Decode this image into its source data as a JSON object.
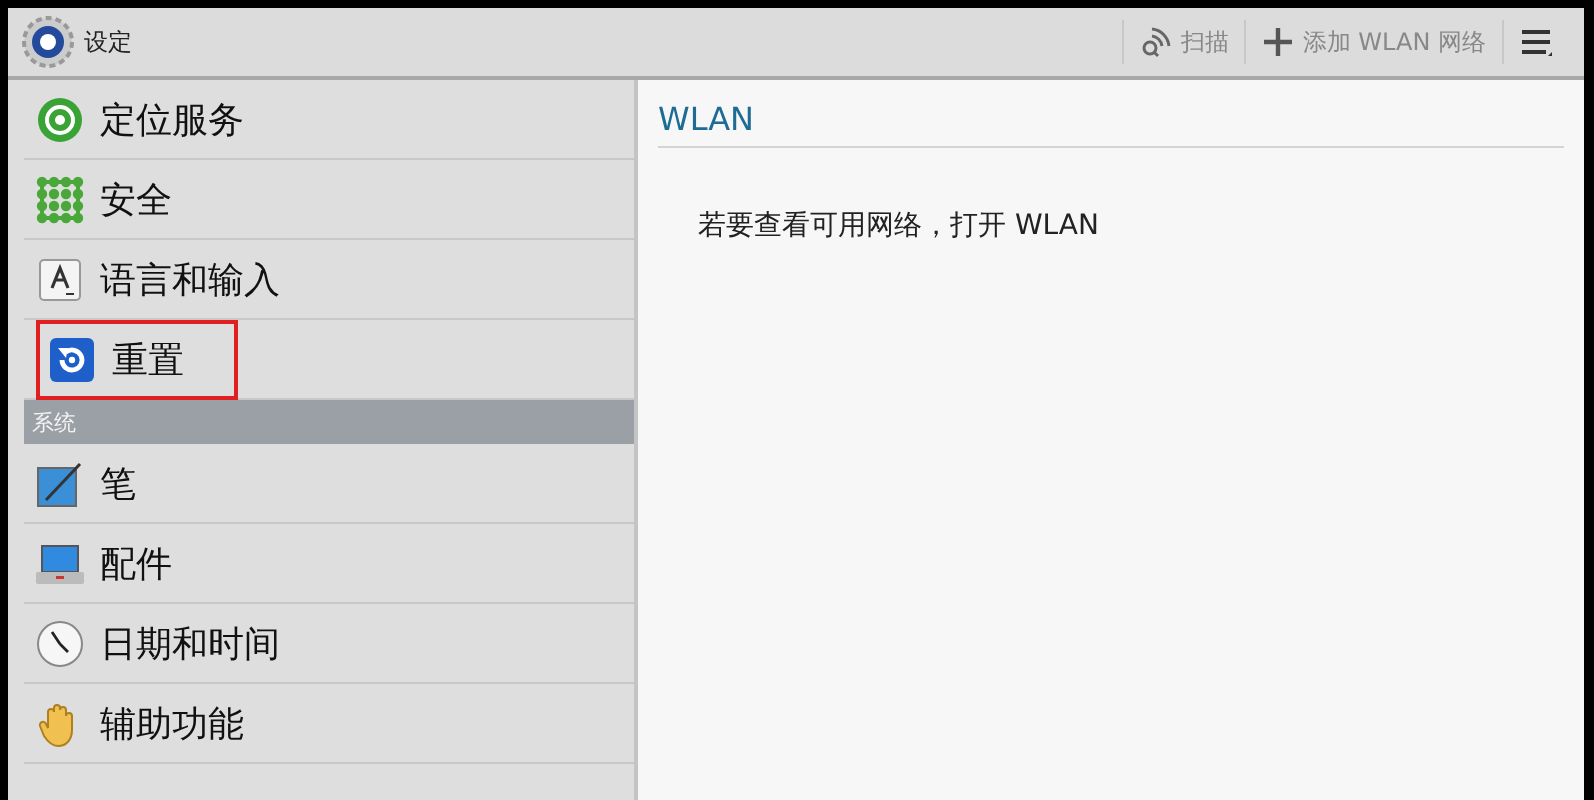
{
  "window": {
    "title": "设定"
  },
  "actions": [
    {
      "kind": "scan",
      "label": "扫描"
    },
    {
      "kind": "add",
      "label": "添加 WLAN 网络"
    },
    {
      "kind": "menu"
    }
  ],
  "sidebar": {
    "items": [
      {
        "kind": "item",
        "label": "定位服务",
        "highlighted": false
      },
      {
        "kind": "item",
        "label": "安全",
        "highlighted": false
      },
      {
        "kind": "item",
        "label": "语言和输入",
        "highlighted": false
      },
      {
        "kind": "item",
        "label": "重置",
        "highlighted": true
      },
      {
        "kind": "header",
        "label": "系统"
      },
      {
        "kind": "item",
        "label": "笔",
        "highlighted": false
      },
      {
        "kind": "item",
        "label": "配件",
        "highlighted": false
      },
      {
        "kind": "item",
        "label": "日期和时间",
        "highlighted": false
      },
      {
        "kind": "item",
        "label": "辅助功能",
        "highlighted": false
      }
    ]
  },
  "detail": {
    "title": "WLAN",
    "message": "若要查看可用网络，打开 WLAN"
  }
}
